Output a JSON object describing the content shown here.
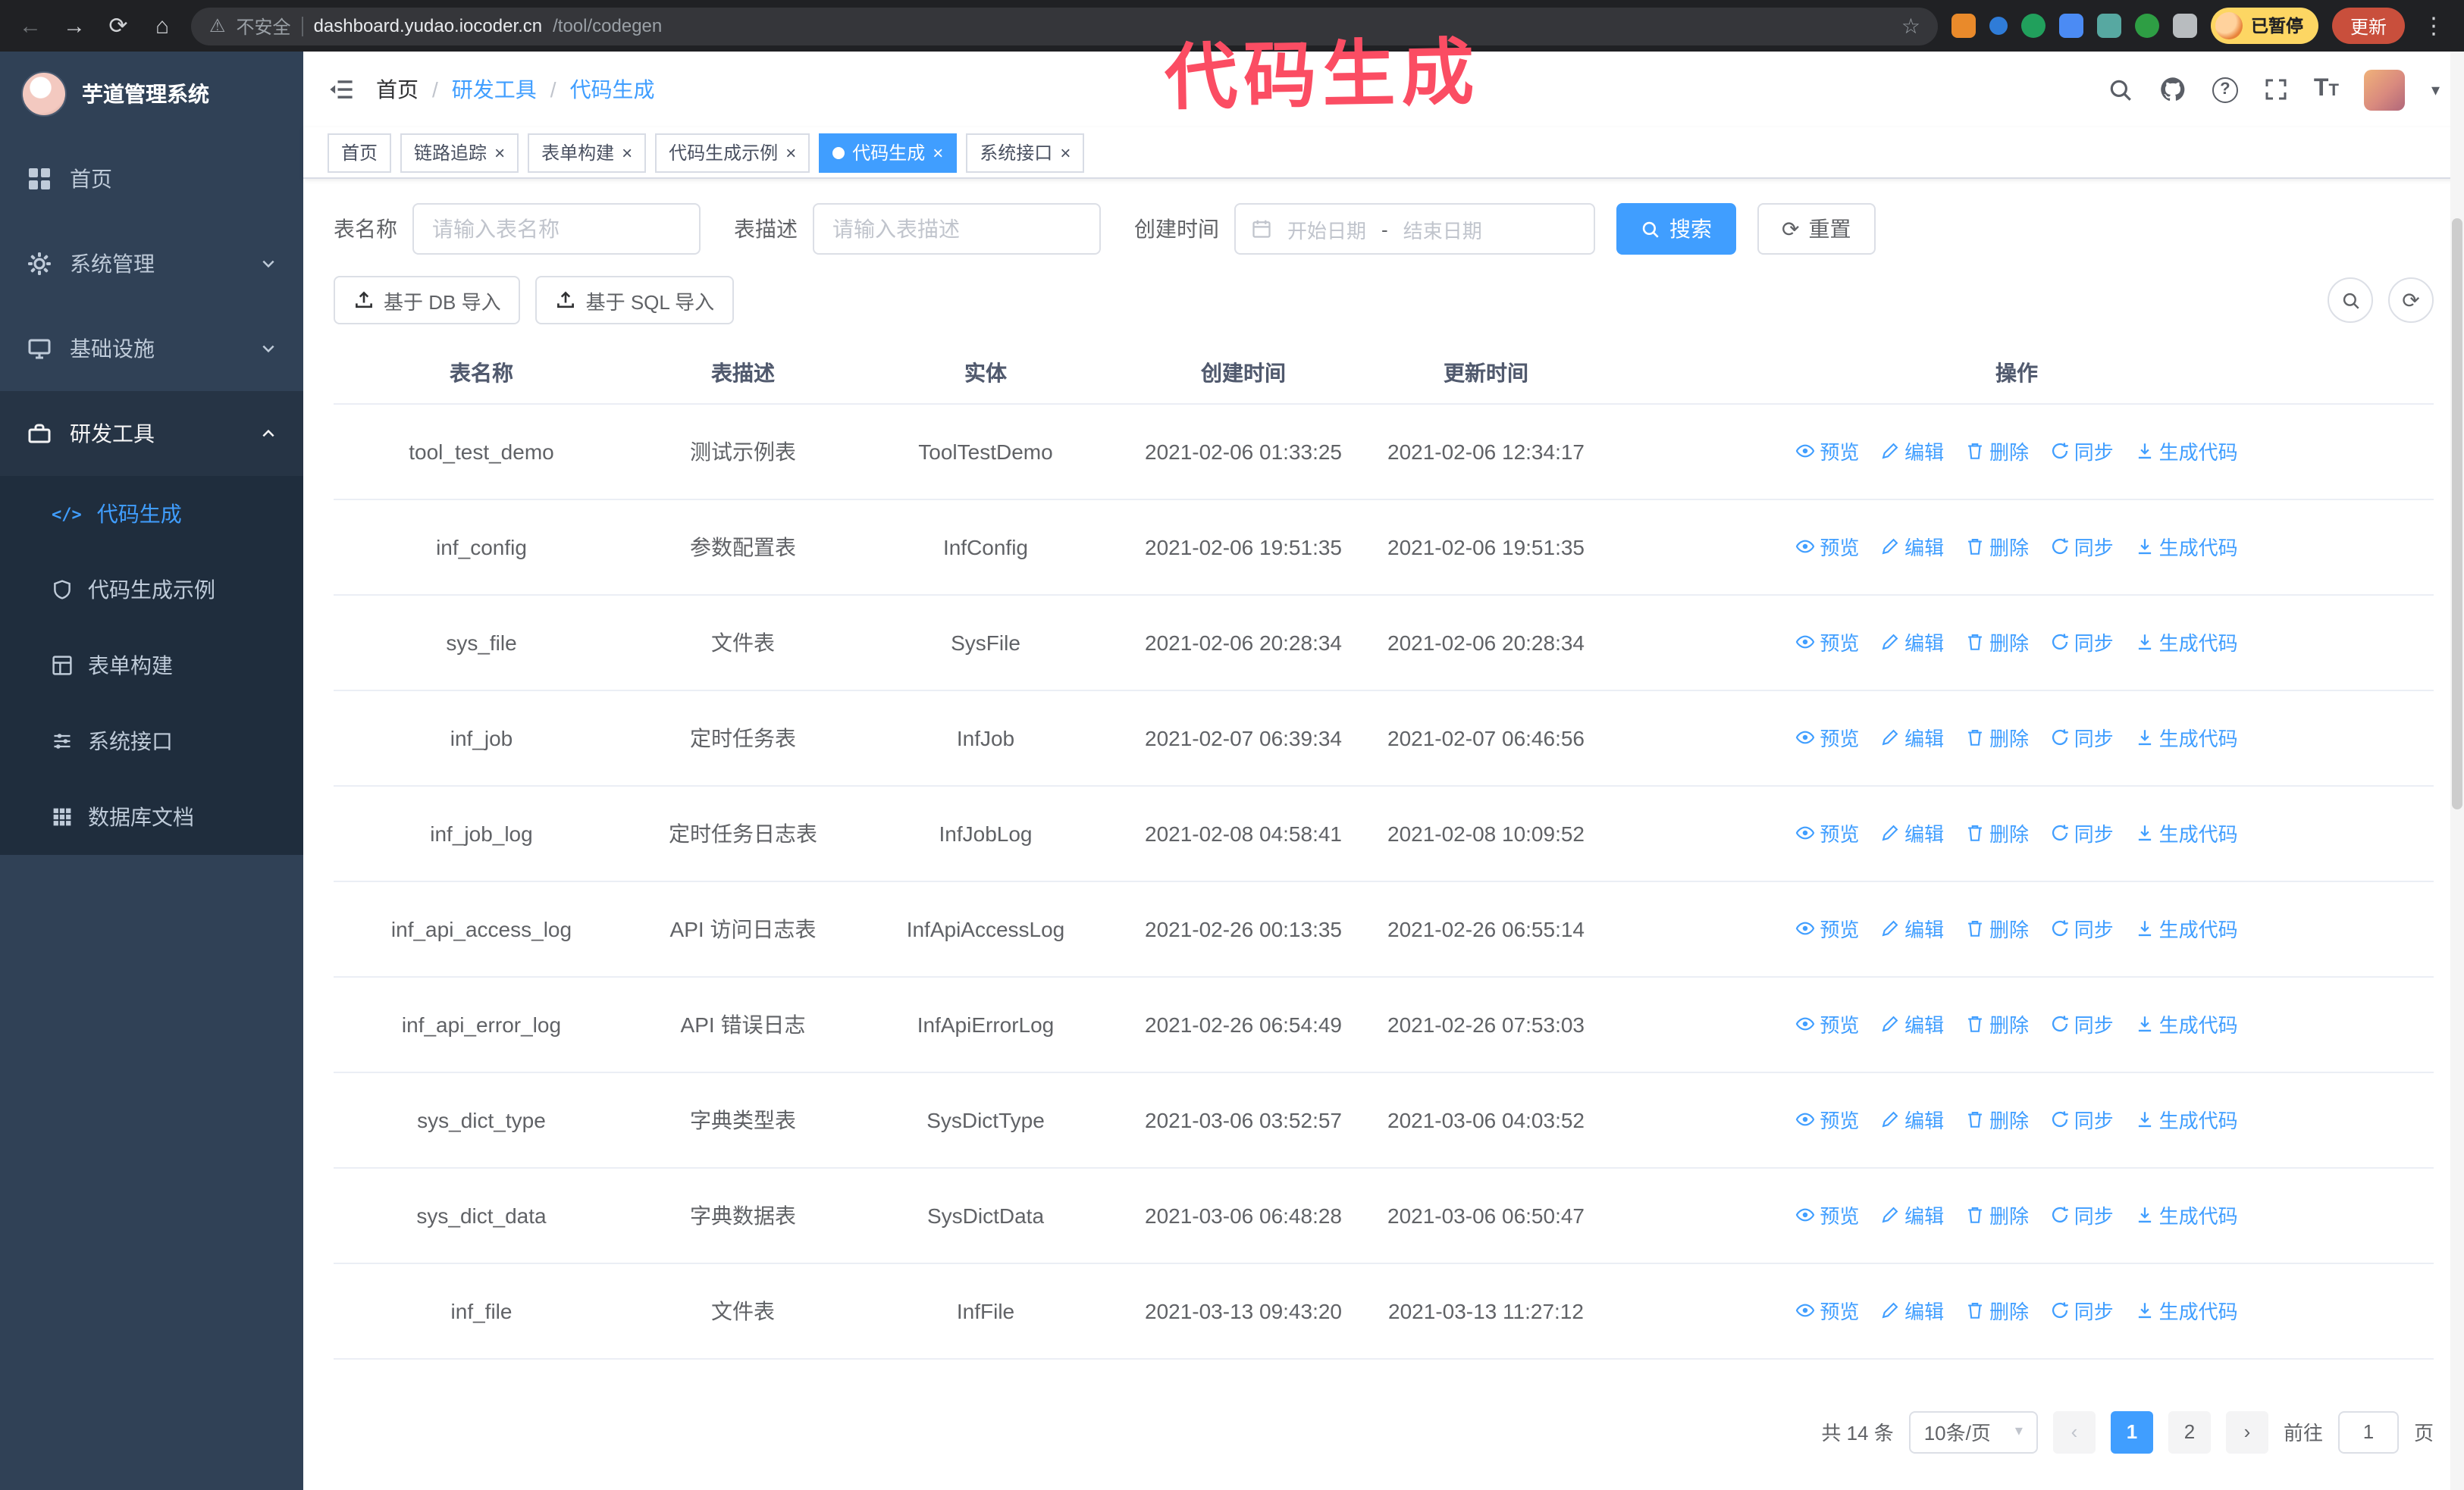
{
  "browser": {
    "security_label": "不安全",
    "url_host": "dashboard.yudao.iocoder.cn",
    "url_path": "/tool/codegen",
    "profile_badge": "已暂停",
    "update_button": "更新"
  },
  "annotation": {
    "text": "代码生成",
    "color": "#fb4d63"
  },
  "icons": {
    "back": "←",
    "forward": "→",
    "reload": "⟳",
    "home": "⌂",
    "warning": "⚠",
    "star": "☆",
    "kebab": "⋮",
    "slash": "/",
    "caret_down": "▾",
    "chevron_left": "‹",
    "chevron_right": "›",
    "close": "×",
    "question": "?",
    "font_size": "T",
    "code": "</>",
    "refresh": "⟳"
  },
  "sidebar": {
    "logo_title": "芋道管理系统",
    "items": [
      {
        "label": "首页"
      },
      {
        "label": "系统管理"
      },
      {
        "label": "基础设施"
      },
      {
        "label": "研发工具"
      }
    ],
    "sub_items": [
      {
        "label": "代码生成"
      },
      {
        "label": "代码生成示例"
      },
      {
        "label": "表单构建"
      },
      {
        "label": "系统接口"
      },
      {
        "label": "数据库文档"
      }
    ]
  },
  "header": {
    "breadcrumb": [
      {
        "label": "首页"
      },
      {
        "label": "研发工具"
      },
      {
        "label": "代码生成"
      }
    ]
  },
  "tabs": [
    {
      "label": "首页"
    },
    {
      "label": "链路追踪"
    },
    {
      "label": "表单构建"
    },
    {
      "label": "代码生成示例"
    },
    {
      "label": "代码生成"
    },
    {
      "label": "系统接口"
    }
  ],
  "filters": {
    "table_name_label": "表名称",
    "table_name_placeholder": "请输入表名称",
    "table_desc_label": "表描述",
    "table_desc_placeholder": "请输入表描述",
    "create_time_label": "创建时间",
    "date_start_placeholder": "开始日期",
    "date_separator": "-",
    "date_end_placeholder": "结束日期",
    "search_button": "搜索",
    "reset_button": "重置"
  },
  "toolbar": {
    "import_db_label": "基于 DB 导入",
    "import_sql_label": "基于 SQL 导入"
  },
  "table": {
    "columns": [
      "表名称",
      "表描述",
      "实体",
      "创建时间",
      "更新时间",
      "操作"
    ],
    "action_labels": [
      "预览",
      "编辑",
      "删除",
      "同步",
      "生成代码"
    ],
    "rows": [
      {
        "name": "tool_test_demo",
        "desc": "测试示例表",
        "entity": "ToolTestDemo",
        "created": "2021-02-06 01:33:25",
        "updated": "2021-02-06 12:34:17"
      },
      {
        "name": "inf_config",
        "desc": "参数配置表",
        "entity": "InfConfig",
        "created": "2021-02-06 19:51:35",
        "updated": "2021-02-06 19:51:35"
      },
      {
        "name": "sys_file",
        "desc": "文件表",
        "entity": "SysFile",
        "created": "2021-02-06 20:28:34",
        "updated": "2021-02-06 20:28:34"
      },
      {
        "name": "inf_job",
        "desc": "定时任务表",
        "entity": "InfJob",
        "created": "2021-02-07 06:39:34",
        "updated": "2021-02-07 06:46:56"
      },
      {
        "name": "inf_job_log",
        "desc": "定时任务日志表",
        "entity": "InfJobLog",
        "created": "2021-02-08 04:58:41",
        "updated": "2021-02-08 10:09:52"
      },
      {
        "name": "inf_api_access_log",
        "desc": "API 访问日志表",
        "entity": "InfApiAccessLog",
        "created": "2021-02-26 00:13:35",
        "updated": "2021-02-26 06:55:14"
      },
      {
        "name": "inf_api_error_log",
        "desc": "API 错误日志",
        "entity": "InfApiErrorLog",
        "created": "2021-02-26 06:54:49",
        "updated": "2021-02-26 07:53:03"
      },
      {
        "name": "sys_dict_type",
        "desc": "字典类型表",
        "entity": "SysDictType",
        "created": "2021-03-06 03:52:57",
        "updated": "2021-03-06 04:03:52"
      },
      {
        "name": "sys_dict_data",
        "desc": "字典数据表",
        "entity": "SysDictData",
        "created": "2021-03-06 06:48:28",
        "updated": "2021-03-06 06:50:47"
      },
      {
        "name": "inf_file",
        "desc": "文件表",
        "entity": "InfFile",
        "created": "2021-03-13 09:43:20",
        "updated": "2021-03-13 11:27:12"
      }
    ]
  },
  "pagination": {
    "total_label": "共 14 条",
    "page_size_label": "10条/页",
    "page_numbers": [
      "1",
      "2"
    ],
    "active_page": "1",
    "goto_prefix": "前往",
    "goto_value": "1",
    "goto_suffix": "页"
  },
  "colors": {
    "accent": "#409eff",
    "sidebar_bg": "#304156",
    "submenu_bg": "#1f2d3d",
    "annotation_pink": "#fb4d63",
    "chrome_bg": "#202124"
  }
}
